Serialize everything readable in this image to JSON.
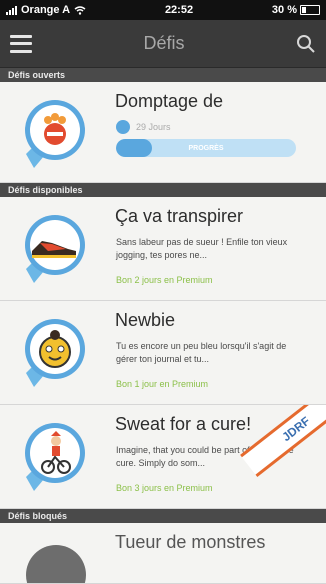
{
  "status": {
    "carrier": "Orange A",
    "time": "22:52",
    "battery": "30 %"
  },
  "header": {
    "title": "Défis"
  },
  "sections": {
    "open": "Défis ouverts",
    "available": "Défis disponibles",
    "locked": "Défis bloqués"
  },
  "open_challenge": {
    "title": "Domptage de",
    "days": "29 Jours",
    "progress_label": "PROGRÈS",
    "progress": 0.2
  },
  "available": [
    {
      "title": "Ça va transpirer",
      "desc": "Sans labeur pas de sueur ! Enfile ton vieux jogging, tes pores ne...",
      "bonus": "Bon 2 jours en Premium"
    },
    {
      "title": "Newbie",
      "desc": "Tu es encore un peu bleu lorsqu'il s'agit de gérer ton journal et tu...",
      "bonus": "Bon 1 jour en Premium"
    },
    {
      "title": "Sweat for a cure!",
      "desc": "Imagine, that you could be part of finding the cure. Simply do som...",
      "bonus": "Bon 3 jours en Premium",
      "ribbon": "JDRF"
    }
  ],
  "locked": {
    "title": "Tueur de monstres"
  },
  "colors": {
    "accent_blue": "#5aa7de",
    "bonus_green": "#8cc04a",
    "ribbon_orange": "#e56a2e"
  }
}
